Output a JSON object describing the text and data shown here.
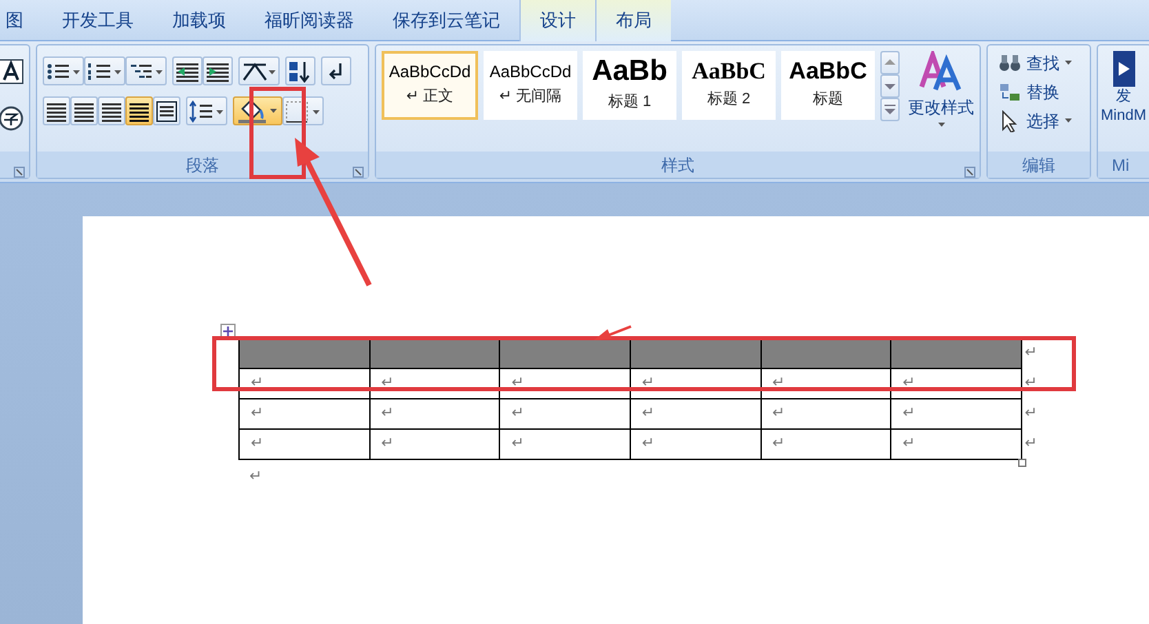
{
  "tabs": [
    {
      "label": "图",
      "kind": "main"
    },
    {
      "label": "开发工具",
      "kind": "main"
    },
    {
      "label": "加载项",
      "kind": "main"
    },
    {
      "label": "福昕阅读器",
      "kind": "main"
    },
    {
      "label": "保存到云笔记",
      "kind": "main"
    },
    {
      "label": "设计",
      "kind": "contextual"
    },
    {
      "label": "布局",
      "kind": "contextual"
    }
  ],
  "paragraph_group": {
    "title": "段落",
    "buttons": [
      {
        "selected": false
      },
      {
        "selected": false
      },
      {
        "selected": false
      },
      {
        "selected": false
      },
      {
        "selected": false
      },
      {
        "selected": false
      },
      {
        "selected": false
      },
      {
        "selected": false
      },
      {
        "selected": false
      },
      {
        "selected": false
      },
      {
        "selected": false
      },
      {
        "selected": true
      },
      {
        "selected": false
      },
      {
        "selected": false
      },
      {
        "selected": true
      },
      {
        "selected": false
      }
    ]
  },
  "styles_group": {
    "title": "样式",
    "styles": [
      {
        "sample": "AaBbCcDd",
        "label": "↵ 正文",
        "kind": "body",
        "selected": true
      },
      {
        "sample": "AaBbCcDd",
        "label": "↵ 无间隔",
        "kind": "body",
        "selected": false
      },
      {
        "sample": "AaBb",
        "label": "标题 1",
        "kind": "heading1",
        "selected": false
      },
      {
        "sample": "AaBbC",
        "label": "标题 2",
        "kind": "heading2",
        "selected": false
      },
      {
        "sample": "AaBbC",
        "label": "标题",
        "kind": "title",
        "selected": false
      }
    ],
    "change_styles": "更改样式"
  },
  "editing_group": {
    "title": "编辑",
    "items": [
      {
        "label": "查找",
        "dropdown": true
      },
      {
        "label": "替换",
        "dropdown": false
      },
      {
        "label": "选择",
        "dropdown": true
      }
    ]
  },
  "mindmanager_group": {
    "button_label": [
      "发",
      "MindM"
    ],
    "title": "Mi"
  },
  "document": {
    "table": {
      "rows": [
        {
          "shaded": true,
          "cells": [
            {},
            {},
            {},
            {},
            {},
            {}
          ],
          "end_mark": "↵"
        },
        {
          "shaded": false,
          "cells": [
            {
              "text": "↵"
            },
            {
              "text": "↵"
            },
            {
              "text": "↵"
            },
            {
              "text": "↵"
            },
            {
              "text": "↵"
            },
            {
              "text": "↵"
            }
          ],
          "end_mark": "↵"
        },
        {
          "shaded": false,
          "cells": [
            {
              "text": "↵"
            },
            {
              "text": "↵"
            },
            {
              "text": "↵"
            },
            {
              "text": "↵"
            },
            {
              "text": "↵"
            },
            {
              "text": "↵"
            }
          ],
          "end_mark": "↵"
        },
        {
          "shaded": false,
          "cells": [
            {
              "text": "↵"
            },
            {
              "text": "↵"
            },
            {
              "text": "↵"
            },
            {
              "text": "↵"
            },
            {
              "text": "↵"
            },
            {
              "text": "↵"
            }
          ],
          "end_mark": "↵"
        }
      ]
    },
    "after_table_mark": "↵"
  }
}
